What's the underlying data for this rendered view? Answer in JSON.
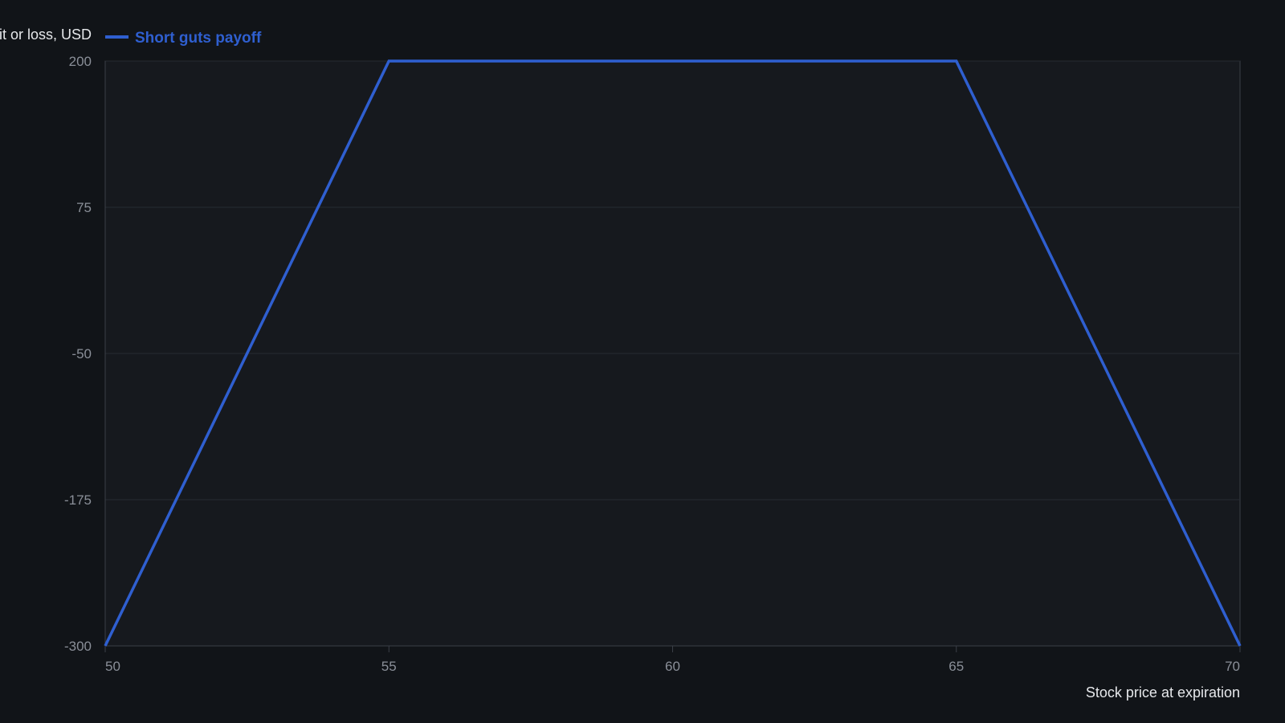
{
  "chart_data": {
    "type": "line",
    "xlabel": "Stock price at expiration",
    "ylabel": "Profit or loss, USD",
    "xlim": [
      50,
      70
    ],
    "ylim": [
      -300,
      200
    ],
    "x_ticks": [
      50,
      55,
      60,
      65,
      70
    ],
    "y_ticks": [
      -300,
      -175,
      -50,
      75,
      200
    ],
    "grid": true,
    "legend_position": "top-left",
    "series": [
      {
        "name": "Short guts payoff",
        "color": "#2f5fd0",
        "x": [
          50,
          55,
          65,
          70
        ],
        "y": [
          -300,
          200,
          200,
          -300
        ]
      }
    ]
  },
  "colors": {
    "background": "#111418",
    "plot_area": "#16191e",
    "grid": "#262a31",
    "axis": "#3a3f47"
  }
}
